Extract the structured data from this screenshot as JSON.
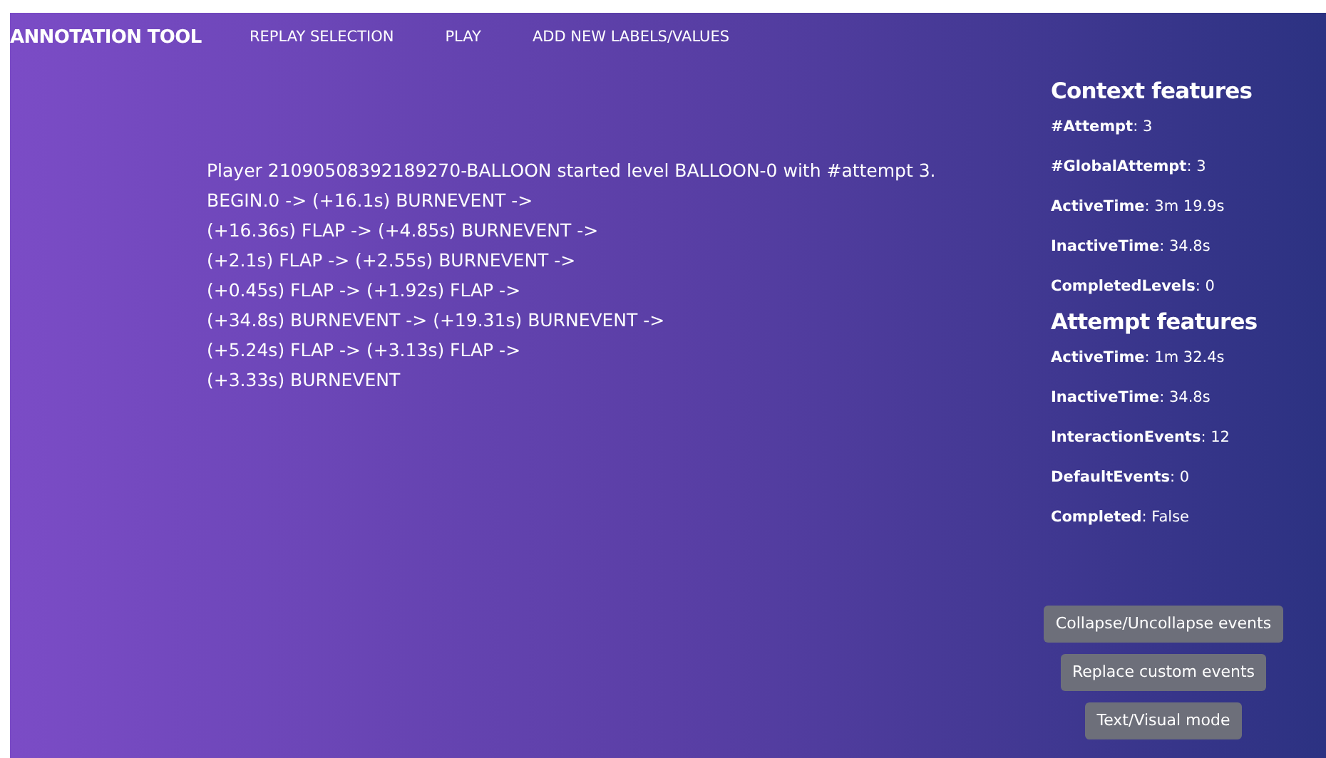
{
  "nav": {
    "brand": "ANNOTATION TOOL",
    "links": [
      "REPLAY SELECTION",
      "PLAY",
      "ADD NEW LABELS/VALUES"
    ]
  },
  "log": {
    "lines": [
      "Player 21090508392189270-BALLOON started level BALLOON-0 with #attempt 3.",
      "BEGIN.0 -> (+16.1s) BURNEVENT ->",
      "(+16.36s) FLAP -> (+4.85s) BURNEVENT ->",
      "(+2.1s) FLAP -> (+2.55s) BURNEVENT ->",
      "(+0.45s) FLAP -> (+1.92s) FLAP ->",
      "(+34.8s) BURNEVENT -> (+19.31s) BURNEVENT ->",
      "(+5.24s) FLAP -> (+3.13s) FLAP ->",
      "(+3.33s) BURNEVENT"
    ]
  },
  "sections": [
    {
      "title": "Context features",
      "features": [
        "**#Attempt**: 3",
        "**#GlobalAttempt**: 3",
        "**ActiveTime**: 3m 19.9s",
        "**InactiveTime**: 34.8s",
        "**CompletedLevels**: 0"
      ]
    },
    {
      "title": "Attempt features",
      "features": [
        "**ActiveTime**: 1m 32.4s",
        "**InactiveTime**: 34.8s",
        "**InteractionEvents**: 12",
        "**DefaultEvents**: 0",
        "**Completed**: False"
      ]
    }
  ],
  "buttons": [
    "Collapse/Uncollapse events",
    "Replace custom events",
    "Text/Visual mode"
  ]
}
